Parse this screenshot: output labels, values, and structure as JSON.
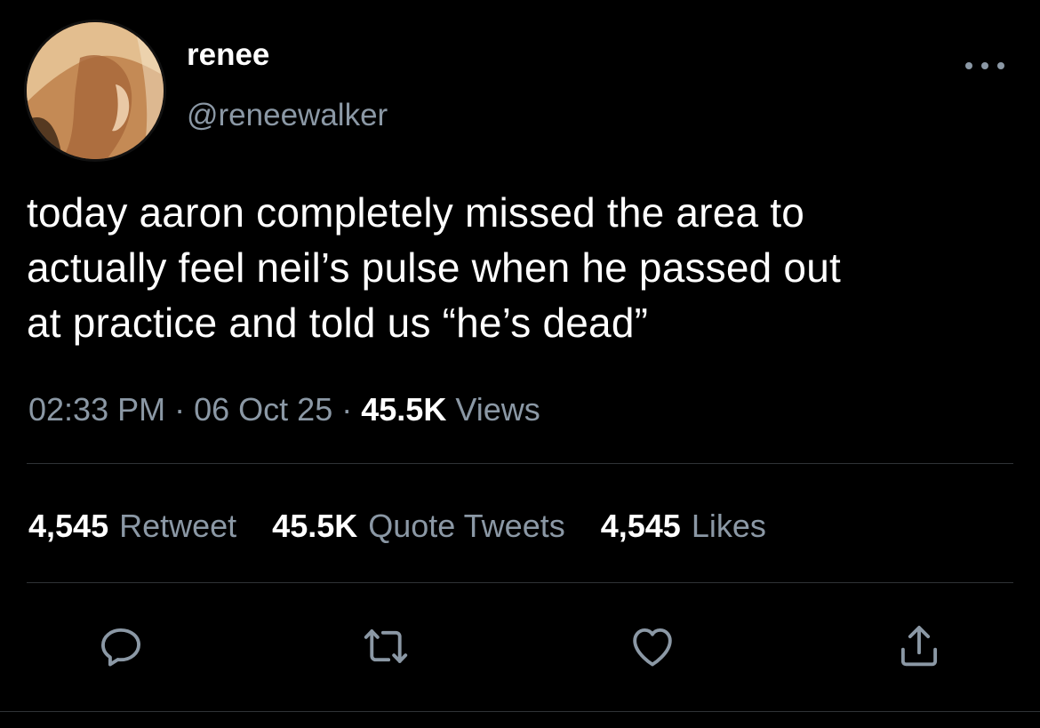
{
  "author": {
    "display_name": "renee",
    "handle": "@reneewalker"
  },
  "tweet": {
    "text_line_1": "today aaron completely missed the area to",
    "text_line_2": "actually feel neil’s pulse when he passed out",
    "text_line_3": "at practice and told us “he’s dead”"
  },
  "meta": {
    "time": "02:33 PM",
    "separator": "·",
    "date": "06 Oct 25",
    "views_count": "45.5K",
    "views_label": "Views"
  },
  "stats": {
    "retweets_count": "4,545",
    "retweets_label": "Retweet",
    "quotes_count": "45.5K",
    "quotes_label": "Quote Tweets",
    "likes_count": "4,545",
    "likes_label": "Likes"
  },
  "icons": {
    "more": "more-horizontal-icon",
    "reply": "reply-bubble-icon",
    "retweet": "retweet-arrows-icon",
    "like": "heart-icon",
    "share": "share-upload-icon"
  },
  "colors": {
    "background": "#000000",
    "text_primary": "#ffffff",
    "text_secondary": "#8b98a5",
    "divider": "#2f3336"
  }
}
